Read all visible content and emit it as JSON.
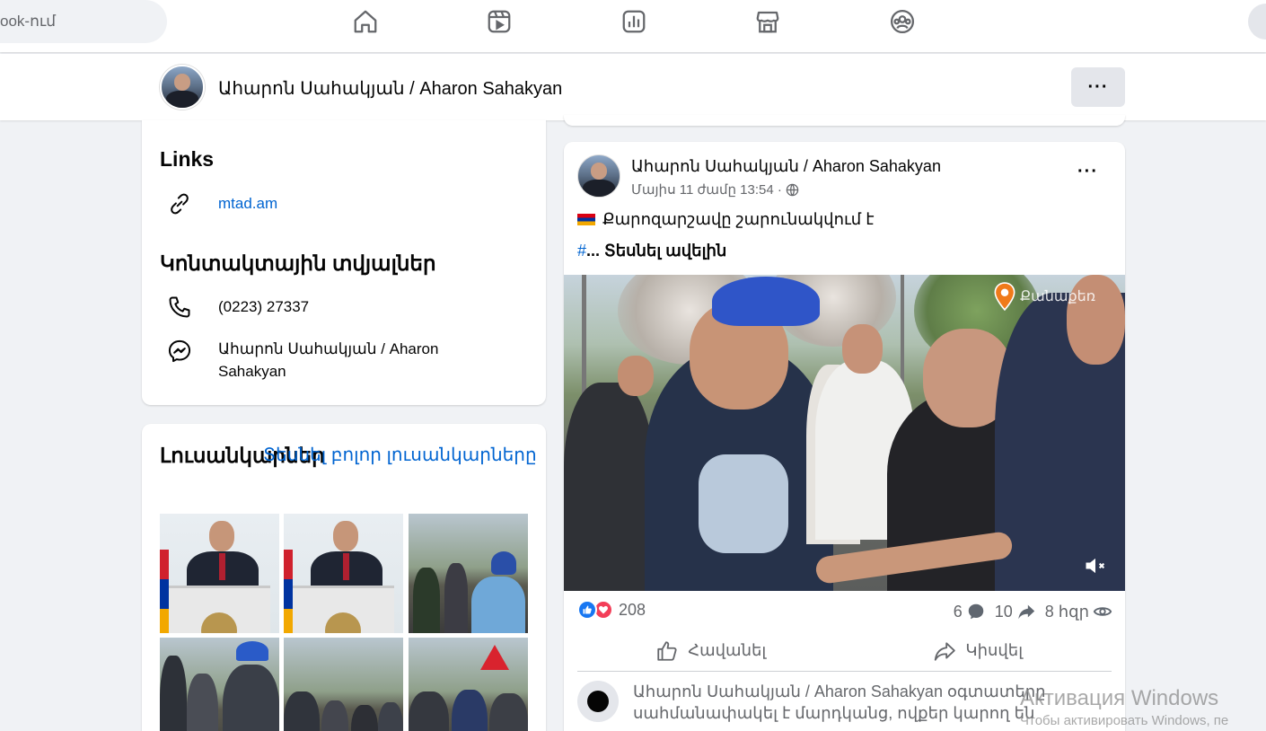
{
  "topbar": {
    "search_placeholder": "ook-ում",
    "nav_icons": [
      "home-icon",
      "video-icon",
      "stats-icon",
      "marketplace-icon",
      "groups-icon"
    ]
  },
  "profile_header": {
    "name": "Ահարոն Սահակյան / Aharon Sahakyan",
    "more_label": "···"
  },
  "intro": {
    "links_title": "Links",
    "website": "mtad.am",
    "contact_title": "Կոնտակտային տվյալներ",
    "phone": "(0223) 27337",
    "messenger": "Ահարոն Սահակյան / Aharon Sahakyan"
  },
  "photos": {
    "title": "Լուսանկարներ",
    "see_all": "Տեսնել բոլոր լուսանկարները"
  },
  "post": {
    "author": "Ահարոն Սահակյան / Aharon Sahakyan",
    "date": "Մայիս 11 ժամը 13:54 ·",
    "more_label": "···",
    "text_line1": "Քարոզարշավը շարունակվում է",
    "hashtag": "#",
    "see_more": "... Տեսնել ավելին",
    "video_location": "Քանաքեռ",
    "reaction_count": "208",
    "comments": "6",
    "shares": "10",
    "views": "8 հզր",
    "like_label": "Հավանել",
    "share_label": "Կիսվել",
    "comment_notice": "Ահարոն Սահակյան / Aharon Sahakyan օգտատերը սահմանափակել է մարդկանց, ովքեր կարող են"
  },
  "watermark": {
    "title": "Активация Windows",
    "subtitle": "Чтобы активировать Windows, пе"
  },
  "colors": {
    "background": "#f0f2f5",
    "link": "#0064d1",
    "like_blue": "#1877f2",
    "love_red": "#f33e58"
  }
}
